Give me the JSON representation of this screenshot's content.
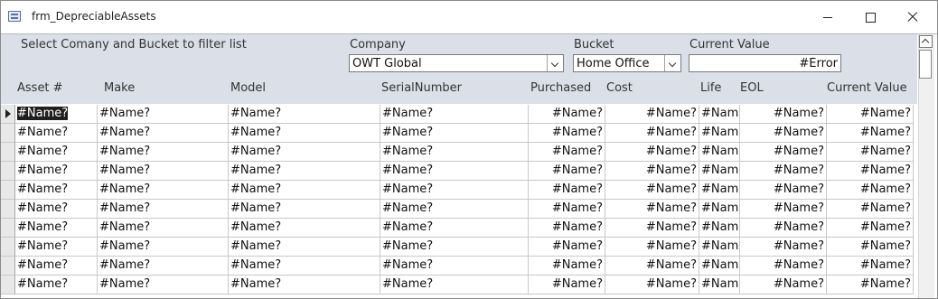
{
  "window": {
    "title": "frm_DepreciableAssets"
  },
  "header": {
    "filter_prompt": "Select Comany and Bucket to filter list",
    "company_label": "Company",
    "company_value": "OWT Global",
    "bucket_label": "Bucket",
    "bucket_value": "Home Office",
    "current_value_label": "Current Value",
    "current_value_value": "#Error"
  },
  "columns": [
    "Asset #",
    "Make",
    "Model",
    "SerialNumber",
    "Purchased",
    "Cost",
    "Life",
    "EOL",
    "Current Value"
  ],
  "rows": [
    [
      "#Name?",
      "#Name?",
      "#Name?",
      "#Name?",
      "#Name?",
      "#Name?",
      "#Name?",
      "#Name?",
      "#Name?"
    ],
    [
      "#Name?",
      "#Name?",
      "#Name?",
      "#Name?",
      "#Name?",
      "#Name?",
      "#Name?",
      "#Name?",
      "#Name?"
    ],
    [
      "#Name?",
      "#Name?",
      "#Name?",
      "#Name?",
      "#Name?",
      "#Name?",
      "#Name?",
      "#Name?",
      "#Name?"
    ],
    [
      "#Name?",
      "#Name?",
      "#Name?",
      "#Name?",
      "#Name?",
      "#Name?",
      "#Name?",
      "#Name?",
      "#Name?"
    ],
    [
      "#Name?",
      "#Name?",
      "#Name?",
      "#Name?",
      "#Name?",
      "#Name?",
      "#Name?",
      "#Name?",
      "#Name?"
    ],
    [
      "#Name?",
      "#Name?",
      "#Name?",
      "#Name?",
      "#Name?",
      "#Name?",
      "#Name?",
      "#Name?",
      "#Name?"
    ],
    [
      "#Name?",
      "#Name?",
      "#Name?",
      "#Name?",
      "#Name?",
      "#Name?",
      "#Name?",
      "#Name?",
      "#Name?"
    ],
    [
      "#Name?",
      "#Name?",
      "#Name?",
      "#Name?",
      "#Name?",
      "#Name?",
      "#Name?",
      "#Name?",
      "#Name?"
    ],
    [
      "#Name?",
      "#Name?",
      "#Name?",
      "#Name?",
      "#Name?",
      "#Name?",
      "#Name?",
      "#Name?",
      "#Name?"
    ],
    [
      "#Name?",
      "#Name?",
      "#Name?",
      "#Name?",
      "#Name?",
      "#Name?",
      "#Name?",
      "#Name?",
      "#Name?"
    ]
  ],
  "icons": {
    "app": "form-icon",
    "minimize": "minimize-icon",
    "maximize": "maximize-icon",
    "close": "close-icon",
    "dropdown": "chevron-down-icon",
    "record_pointer": "record-pointer-icon",
    "scroll_up": "chevron-up-icon"
  },
  "colors": {
    "header_bg": "#dadfe8",
    "selected_cell_bg": "#1f1f1f"
  }
}
